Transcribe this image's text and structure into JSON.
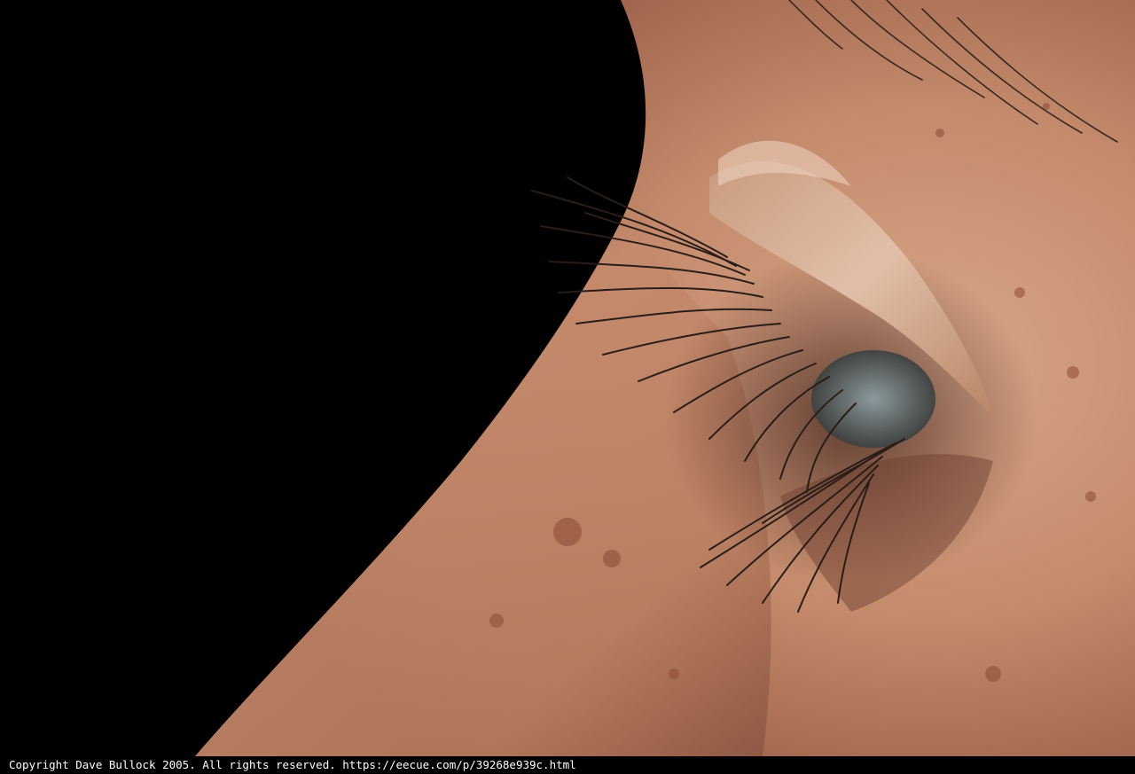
{
  "caption": {
    "text": "Copyright Dave Bullock 2005. All rights reserved. https://eecue.com/p/39268e939c.html"
  },
  "photo": {
    "subject": "close-up profile of closed eye with eyelashes",
    "colors": {
      "background": "#000000",
      "skin_light": "#d9a98c",
      "skin_mid": "#b57a5c",
      "skin_shadow": "#5a3426",
      "lash": "#2a1d17"
    }
  }
}
